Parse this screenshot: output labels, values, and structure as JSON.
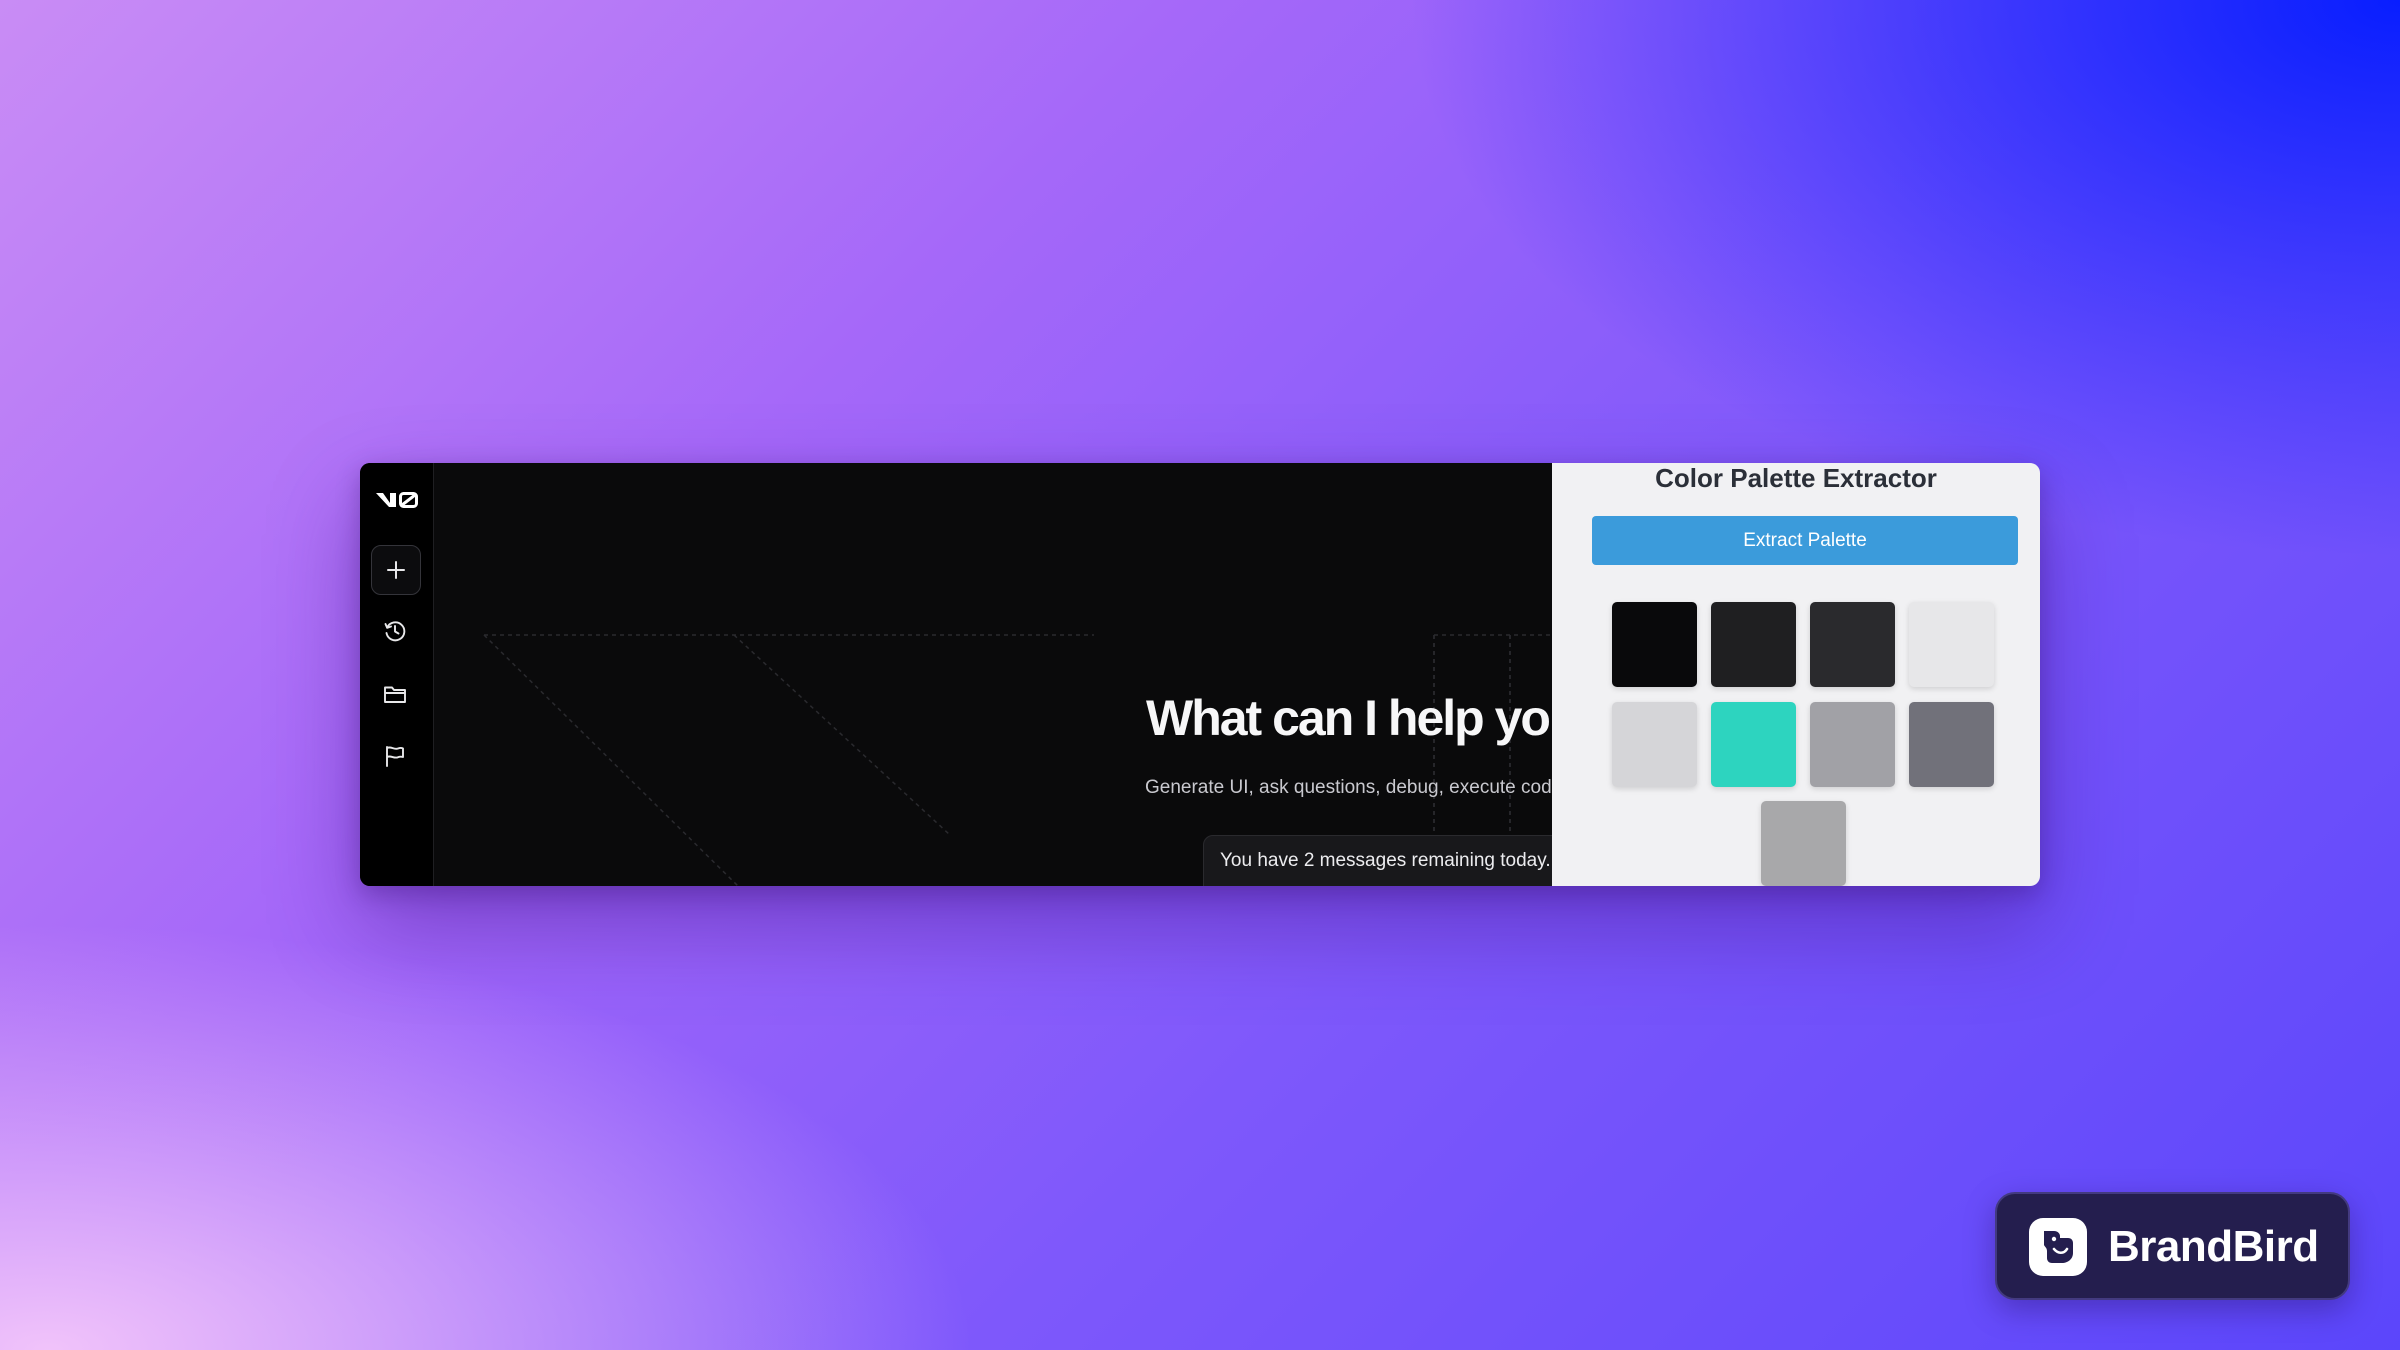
{
  "v0_app": {
    "main": {
      "headline": "What can I help you s",
      "subline": "Generate UI, ask questions, debug, execute code, and",
      "notice": "You have 2 messages remaining today."
    }
  },
  "extractor": {
    "title": "Color Palette Extractor",
    "button_label": "Extract Palette",
    "swatches": [
      "#09090b",
      "#1f1f21",
      "#2a2a2d",
      "#e7e7e9",
      "#d5d5d8",
      "#2dd4bf",
      "#a1a1a6",
      "#71717a",
      "#a8a8aa"
    ]
  },
  "badge": {
    "label": "BrandBird"
  }
}
